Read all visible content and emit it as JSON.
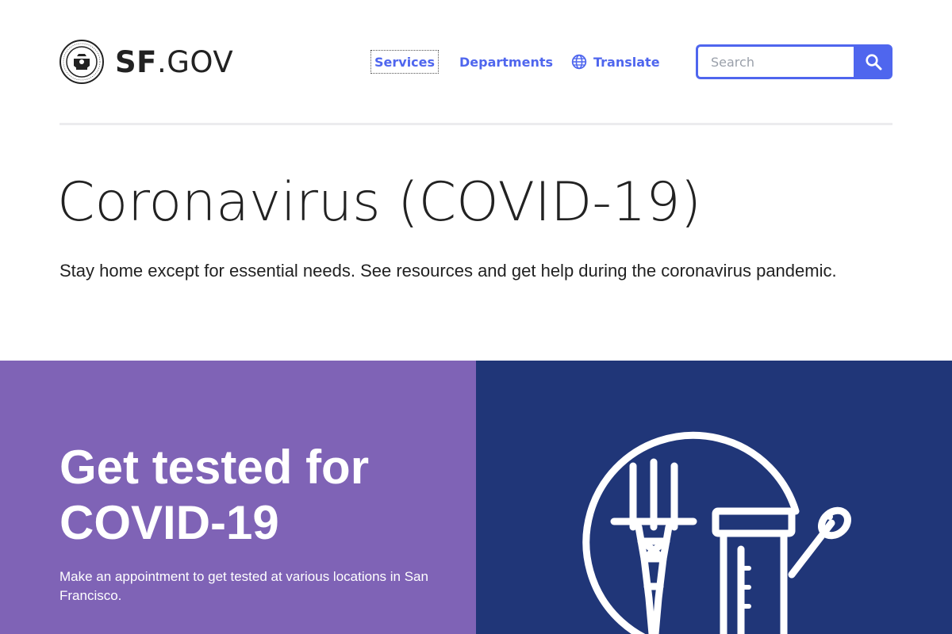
{
  "header": {
    "logo": {
      "brand_bold": "SF",
      "brand_rest": ".GOV"
    },
    "nav": [
      {
        "label": "Services"
      },
      {
        "label": "Departments"
      },
      {
        "label": "Translate",
        "icon": "globe-icon"
      }
    ],
    "search": {
      "placeholder": "Search",
      "value": "",
      "icon": "search-icon"
    }
  },
  "main": {
    "title": "Coronavirus (COVID-19)",
    "intro": "Stay home except for essential needs. See resources and get help during the coronavirus pandemic."
  },
  "feature_card": {
    "title": "Get tested for COVID-19",
    "body": "Make an appointment to get tested at various locations in San Francisco.",
    "illustration": "sutro-tower-test-tube-icon"
  },
  "colors": {
    "accent": "#4f66ee",
    "card_left": "#7f63b6",
    "card_right": "#203678",
    "text": "#222222"
  }
}
